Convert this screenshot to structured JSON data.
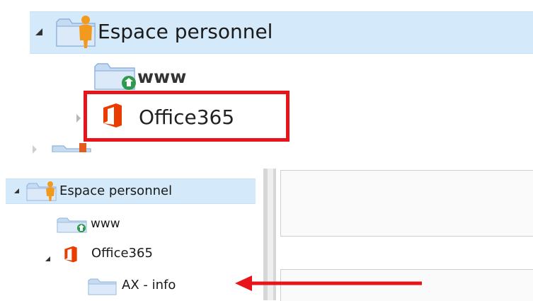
{
  "top_tree": {
    "root": {
      "label": "Espace personnel",
      "expanded": true
    },
    "children": [
      {
        "label": "www"
      },
      {
        "label": "Office365"
      }
    ]
  },
  "bottom_tree": {
    "root": {
      "label": "Espace personnel",
      "expanded": true
    },
    "children": [
      {
        "label": "www"
      },
      {
        "label": "Office365",
        "expanded": true,
        "children": [
          {
            "label": "AX - info"
          }
        ]
      }
    ]
  },
  "annotations": {
    "highlight_color": "#e8141b",
    "arrow_color": "#e8141b"
  },
  "colors": {
    "selection": "#d4e9f9",
    "office_red": "#eb3c00",
    "folder": "#c6dbf2",
    "person": "#f29a1e",
    "globe": "#2e9a4e"
  }
}
